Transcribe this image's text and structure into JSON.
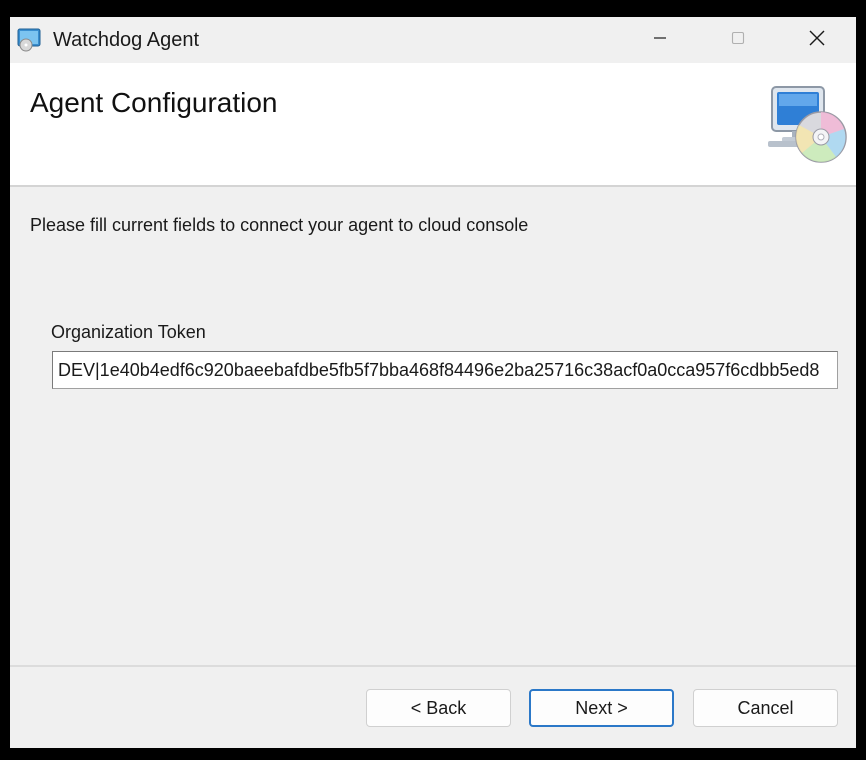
{
  "window": {
    "title": "Watchdog Agent",
    "controls": {
      "minimize_icon": "minimize-icon",
      "maximize_icon": "maximize-icon",
      "close_icon": "close-icon"
    }
  },
  "banner": {
    "title": "Agent Configuration",
    "icon": "computer-cd-icon"
  },
  "body": {
    "instruction": "Please fill current fields to connect your agent to cloud console",
    "token_label": "Organization Token",
    "token_value": "DEV|1e40b4edf6c920baeebafdbe5fb5f7bba468f84496e2ba25716c38acf0a0cca957f6cdbb5ed8"
  },
  "footer": {
    "back_label": "< Back",
    "next_label": "Next >",
    "cancel_label": "Cancel"
  },
  "colors": {
    "accent": "#2b78c8",
    "window_bg": "#f0f0f0",
    "banner_bg": "#ffffff"
  }
}
